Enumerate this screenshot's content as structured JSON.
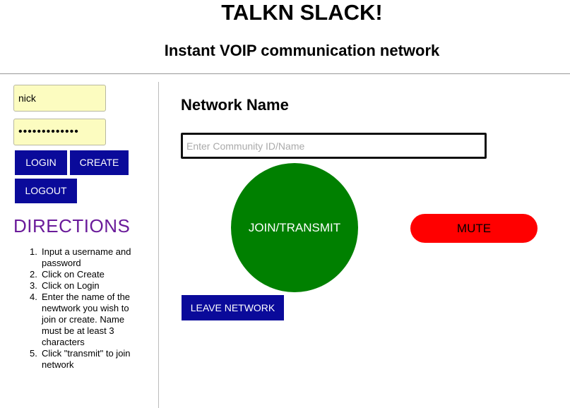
{
  "header": {
    "title": "TALKN SLACK!",
    "subtitle": "Instant VOIP communication network"
  },
  "sidebar": {
    "username_value": "nick",
    "password_value": "•••••••••••••",
    "login_label": "LOGIN",
    "create_label": "CREATE",
    "logout_label": "LOGOUT",
    "directions_title": "DIRECTIONS",
    "directions": [
      {
        "num": "1.",
        "text": "Input a username and password"
      },
      {
        "num": "2.",
        "text": "Click on Create"
      },
      {
        "num": "3.",
        "text": "Click on Login"
      },
      {
        "num": "4.",
        "text": "Enter the name of the newtwork you wish to join or create. Name must be at least 3 characters"
      },
      {
        "num": "5.",
        "text": "Click \"transmit\" to join network"
      }
    ]
  },
  "main": {
    "network_title": "Network Name",
    "network_placeholder": "Enter Community ID/Name",
    "join_label": "JOIN/TRANSMIT",
    "mute_label": "MUTE",
    "leave_label": "LEAVE NETWORK"
  },
  "colors": {
    "primary_button": "#0a0a9a",
    "join_button": "#008000",
    "mute_button": "#ff0000",
    "input_bg": "#fcfcc0",
    "directions_heading": "#6a1b9a"
  }
}
